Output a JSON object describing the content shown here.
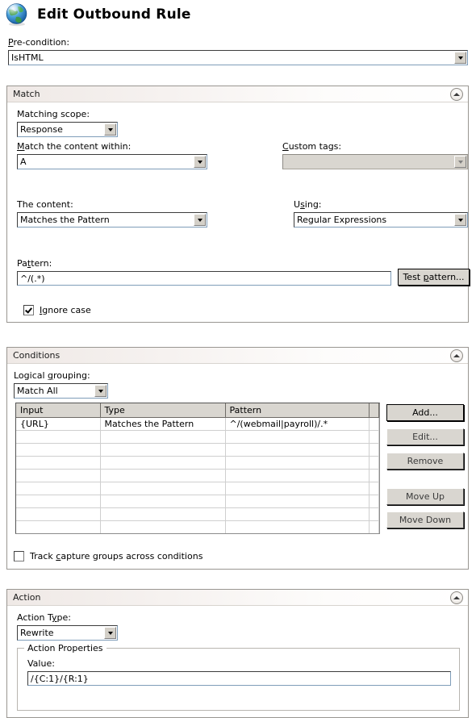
{
  "header": {
    "icon": "globe-icon",
    "title": "Edit Outbound Rule"
  },
  "precondition": {
    "label": "Pre-condition:",
    "value": "IsHTML"
  },
  "match": {
    "section_title": "Match",
    "collapse_icon": "chevron-up-icon",
    "matching_scope": {
      "label": "Matching scope:",
      "value": "Response"
    },
    "content_within": {
      "label": "Match the content within:",
      "value": "A"
    },
    "custom_tags": {
      "label": "Custom tags:",
      "value": "",
      "disabled": true
    },
    "the_content": {
      "label": "The content:",
      "value": "Matches the Pattern"
    },
    "using": {
      "label": "Using:",
      "value": "Regular Expressions"
    },
    "pattern": {
      "label": "Pattern:",
      "value": "^/(.*)"
    },
    "test_pattern_label": "Test pattern...",
    "ignore_case": {
      "label": "Ignore case",
      "checked": true
    }
  },
  "conditions": {
    "section_title": "Conditions",
    "collapse_icon": "chevron-up-icon",
    "logical_grouping": {
      "label": "Logical grouping:",
      "value": "Match All"
    },
    "columns": [
      "Input",
      "Type",
      "Pattern"
    ],
    "rows": [
      {
        "input": "{URL}",
        "type": "Matches the Pattern",
        "pattern": "^/(webmail|payroll)/.*"
      }
    ],
    "empty_row_count": 8,
    "buttons": [
      {
        "label": "Add...",
        "enabled": true
      },
      {
        "label": "Edit...",
        "enabled": false
      },
      {
        "label": "Remove",
        "enabled": false
      },
      {
        "label": "Move Up",
        "enabled": false
      },
      {
        "label": "Move Down",
        "enabled": false
      }
    ],
    "track_capture_groups": {
      "label": "Track capture groups across conditions",
      "checked": false
    }
  },
  "action": {
    "section_title": "Action",
    "collapse_icon": "chevron-up-icon",
    "action_type": {
      "label": "Action Type:",
      "value": "Rewrite"
    },
    "action_properties": {
      "legend": "Action Properties",
      "value_label": "Value:",
      "value": "/{C:1}/{R:1}"
    }
  },
  "colors": {
    "panel_border": "#999691",
    "header_gradient_start": "#efe9e6",
    "input_border": "#7f9db9",
    "button_face": "#d9d6d0",
    "grid_header": "#d9d6d0"
  }
}
